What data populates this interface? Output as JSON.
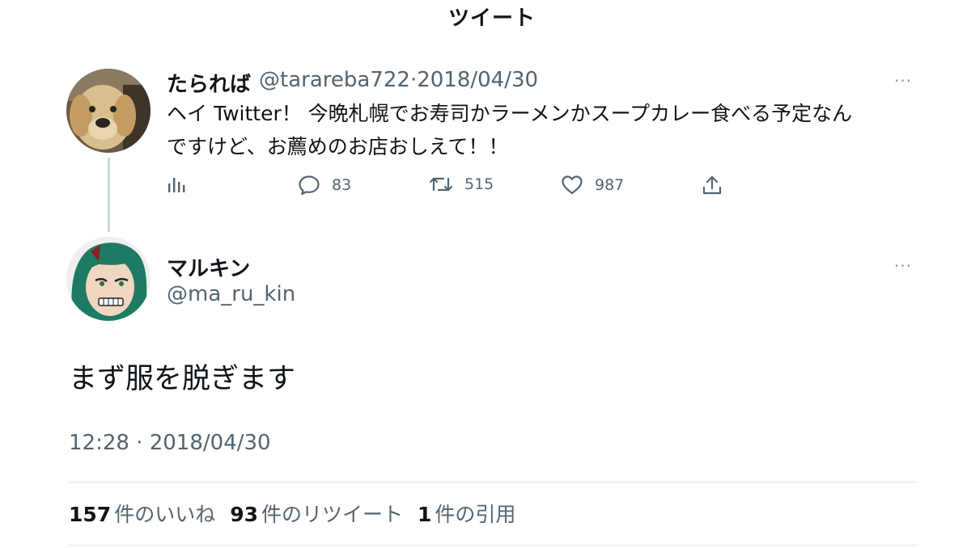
{
  "header": {
    "title": "ツイート"
  },
  "original_tweet": {
    "name": "たられば",
    "handle": "@tarareba722",
    "separator": "·",
    "date": "2018/04/30",
    "more_label": "···",
    "text_line1": "ヘイ Twitter！ 今晩札幌でお寿司かラーメンかスープカレー食べる予定なん",
    "text_line2": "ですけど、お薦めのお店おしえて！！",
    "actions": {
      "analytics_icon": "bar-chart-icon",
      "reply_count": "83",
      "retweet_count": "515",
      "like_count": "987",
      "share_icon": "share-icon"
    }
  },
  "reply_tweet": {
    "name": "マルキン",
    "handle": "@ma_ru_kin",
    "more_label": "···",
    "text": "まず服を脱ぎます",
    "timestamp": "12:28 · 2018/04/30"
  },
  "stats": {
    "likes_count": "157",
    "likes_label": "件のいいね",
    "retweets_count": "93",
    "retweets_label": "件のリツイート",
    "quotes_count": "1",
    "quotes_label": "件の引用"
  },
  "colors": {
    "secondary_text": "#536471",
    "thread_line": "#cfd9de",
    "divider": "#e3e6e8"
  }
}
